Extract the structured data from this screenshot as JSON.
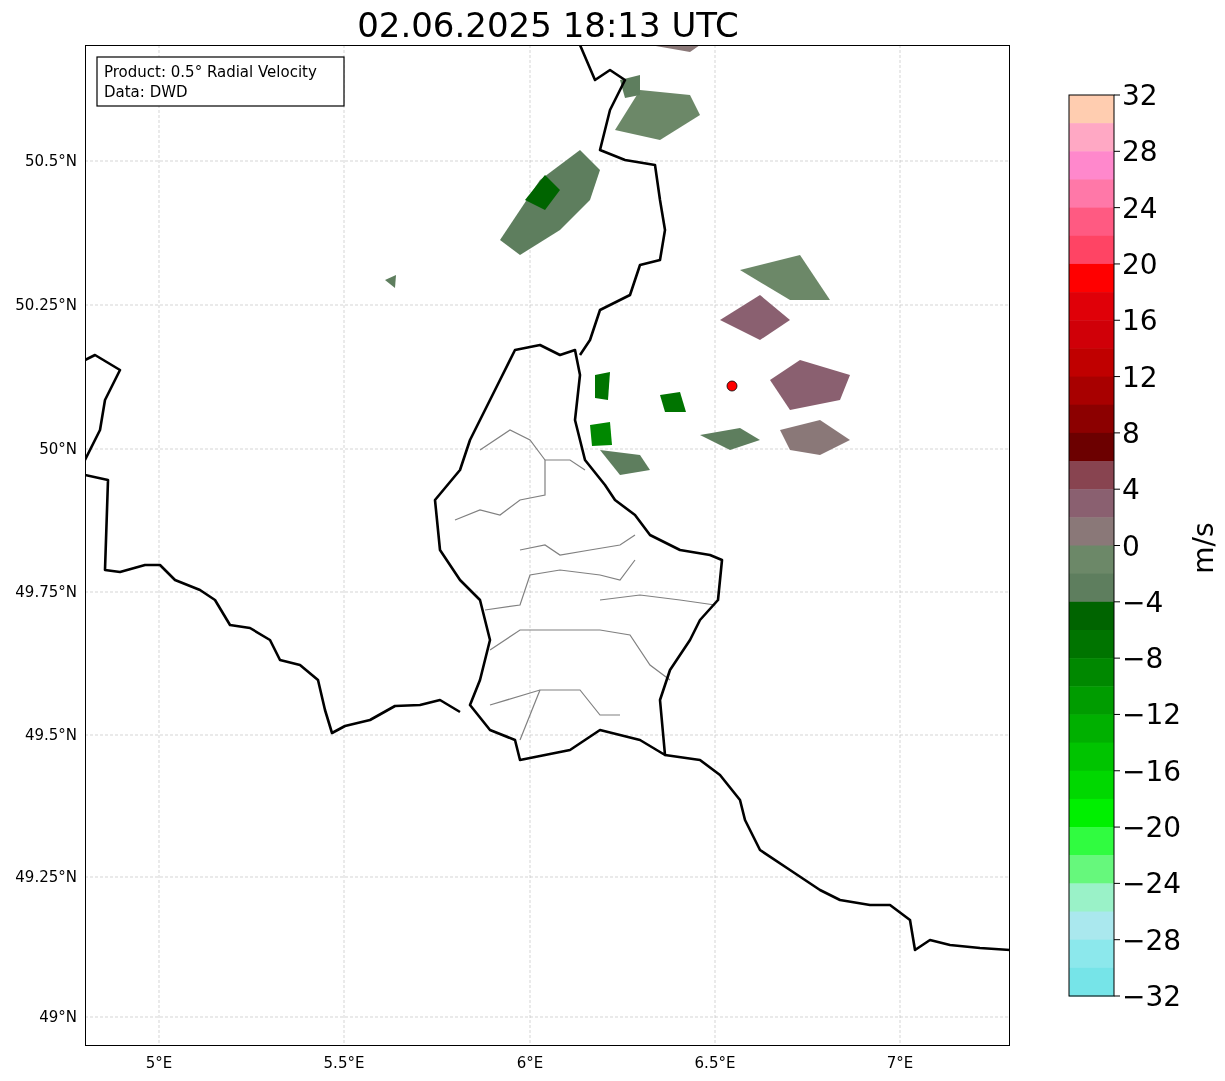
{
  "title": "02.06.2025 18:13 UTC",
  "info_box": {
    "lines": [
      "Product: 0.5° Radial Velocity",
      "Data: DWD"
    ]
  },
  "lat_labels": [
    "50.5°N",
    "50.25°N",
    "50°N",
    "49.75°N",
    "49.5°N",
    "49.25°N",
    "49°N"
  ],
  "lon_labels": [
    "5°E",
    "5.5°E",
    "6°E",
    "6.5°E",
    "7°E"
  ],
  "colorbar": {
    "label": "m/s",
    "ticks": [
      "32",
      "28",
      "24",
      "20",
      "16",
      "12",
      "8",
      "4",
      "0",
      "−4",
      "−8",
      "−12",
      "−16",
      "−20",
      "−24",
      "−28",
      "−32"
    ],
    "segments": [
      {
        "color": "#ffcdb0"
      },
      {
        "color": "#ffa8c4"
      },
      {
        "color": "#ff88cc"
      },
      {
        "color": "#ff78a8"
      },
      {
        "color": "#ff5a82"
      },
      {
        "color": "#ff4464"
      },
      {
        "color": "#ff0000"
      },
      {
        "color": "#e00008"
      },
      {
        "color": "#d00008"
      },
      {
        "color": "#c00000"
      },
      {
        "color": "#a80000"
      },
      {
        "color": "#8c0000"
      },
      {
        "color": "#6c0000"
      },
      {
        "color": "#884450"
      },
      {
        "color": "#8a6070"
      },
      {
        "color": "#8a7878"
      },
      {
        "color": "#6c8868"
      },
      {
        "color": "#5e7e5e"
      },
      {
        "color": "#006400"
      },
      {
        "color": "#007400"
      },
      {
        "color": "#008800"
      },
      {
        "color": "#009c00"
      },
      {
        "color": "#00b000"
      },
      {
        "color": "#00c400"
      },
      {
        "color": "#00d800"
      },
      {
        "color": "#00f000"
      },
      {
        "color": "#30fc40"
      },
      {
        "color": "#66f87c"
      },
      {
        "color": "#9af2c8"
      },
      {
        "color": "#aae8ee"
      },
      {
        "color": "#8ce8ec"
      },
      {
        "color": "#76e4e8"
      }
    ]
  }
}
